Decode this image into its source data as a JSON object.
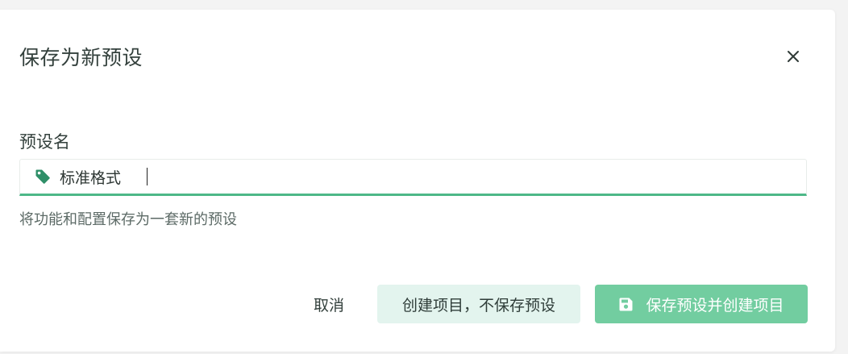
{
  "dialog": {
    "title": "保存为新预设",
    "close_icon": "close-icon"
  },
  "form": {
    "label": "预设名",
    "input": {
      "icon": "tag-icon",
      "value": "标准格式"
    },
    "hint": "将功能和配置保存为一套新的预设"
  },
  "actions": {
    "cancel_label": "取消",
    "secondary_label": "创建项目，不保存预设",
    "primary_label": "保存预设并创建项目",
    "primary_icon": "save-icon"
  },
  "colors": {
    "accent": "#4db888",
    "primary_button": "#72cda0",
    "secondary_button": "#e3f4ee",
    "tag_icon": "#2f8f68"
  }
}
